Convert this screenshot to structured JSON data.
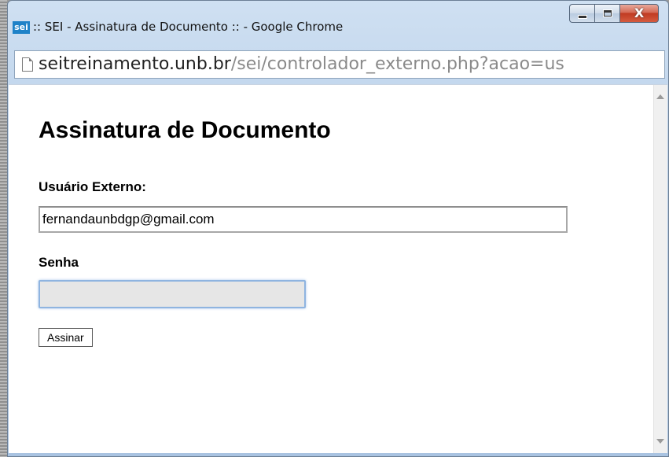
{
  "window": {
    "app_logo": "sei",
    "title": ":: SEI - Assinatura de Documento :: - Google Chrome",
    "controls": {
      "minimize_icon": "minimize-icon",
      "maximize_icon": "maximize-icon",
      "close_icon": "close-icon",
      "close_glyph": "X"
    }
  },
  "address_bar": {
    "page_icon": "page-icon",
    "host": "seitreinamento.unb.br",
    "path": "/sei/controlador_externo.php?acao=us"
  },
  "page": {
    "title": "Assinatura de Documento",
    "user_label": "Usuário Externo:",
    "user_value": "fernandaunbdgp@gmail.com",
    "password_label": "Senha",
    "password_value": "",
    "sign_button": "Assinar"
  },
  "colors": {
    "window_frame": "#b7cee8",
    "close_button": "#c03b22",
    "focus_border": "#8fb4e0",
    "url_path": "#8a8a8a"
  }
}
